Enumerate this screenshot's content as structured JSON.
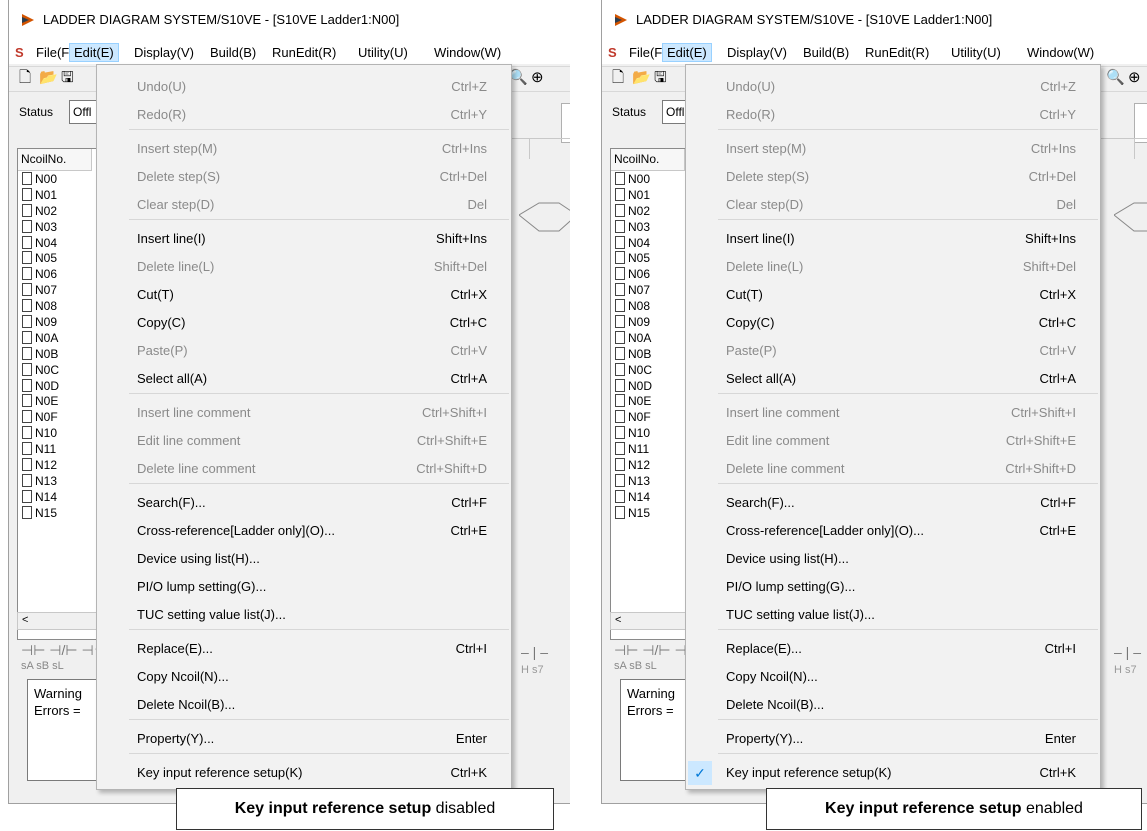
{
  "window_title": "LADDER DIAGRAM SYSTEM/S10VE - [S10VE Ladder1:N00]",
  "system_menu_icon": "S",
  "menubar": [
    {
      "label": "File(F)"
    },
    {
      "label": "Edit(E)"
    },
    {
      "label": "Display(V)"
    },
    {
      "label": "Build(B)"
    },
    {
      "label": "RunEdit(R)"
    },
    {
      "label": "Utility(U)"
    },
    {
      "label": "Window(W)"
    }
  ],
  "status_label": "Status",
  "status_value": "Offl",
  "list_header": "NcoilNo.",
  "ncoils": [
    "N00",
    "N01",
    "N02",
    "N03",
    "N04",
    "N05",
    "N06",
    "N07",
    "N08",
    "N09",
    "N0A",
    "N0B",
    "N0C",
    "N0D",
    "N0E",
    "N0F",
    "N10",
    "N11",
    "N12",
    "N13",
    "N14",
    "N15"
  ],
  "scroll_left": "<",
  "ladder_symbols": "sA  sB  sL",
  "ladder_symbols_right": "H   s7",
  "messages": [
    "Warning",
    "Errors ="
  ],
  "edit_menu": [
    {
      "label": "Undo(U)",
      "shortcut": "Ctrl+Z",
      "enabled": false
    },
    {
      "label": "Redo(R)",
      "shortcut": "Ctrl+Y",
      "enabled": false
    },
    {
      "label": "Insert step(M)",
      "shortcut": "Ctrl+Ins",
      "enabled": false
    },
    {
      "label": "Delete step(S)",
      "shortcut": "Ctrl+Del",
      "enabled": false
    },
    {
      "label": "Clear step(D)",
      "shortcut": "Del",
      "enabled": false
    },
    {
      "label": "Insert line(I)",
      "shortcut": "Shift+Ins",
      "enabled": true
    },
    {
      "label": "Delete line(L)",
      "shortcut": "Shift+Del",
      "enabled": false
    },
    {
      "label": "Cut(T)",
      "shortcut": "Ctrl+X",
      "enabled": true
    },
    {
      "label": "Copy(C)",
      "shortcut": "Ctrl+C",
      "enabled": true
    },
    {
      "label": "Paste(P)",
      "shortcut": "Ctrl+V",
      "enabled": false
    },
    {
      "label": "Select all(A)",
      "shortcut": "Ctrl+A",
      "enabled": true
    },
    {
      "label": "Insert line comment",
      "shortcut": "Ctrl+Shift+I",
      "enabled": false
    },
    {
      "label": "Edit line comment",
      "shortcut": "Ctrl+Shift+E",
      "enabled": false
    },
    {
      "label": "Delete line comment",
      "shortcut": "Ctrl+Shift+D",
      "enabled": false
    },
    {
      "label": "Search(F)...",
      "shortcut": "Ctrl+F",
      "enabled": true
    },
    {
      "label": "Cross-reference[Ladder only](O)...",
      "shortcut": "Ctrl+E",
      "enabled": true
    },
    {
      "label": "Device using list(H)...",
      "shortcut": "",
      "enabled": true
    },
    {
      "label": "PI/O lump setting(G)...",
      "shortcut": "",
      "enabled": true
    },
    {
      "label": "TUC setting value list(J)...",
      "shortcut": "",
      "enabled": true
    },
    {
      "label": "Replace(E)...",
      "shortcut": "Ctrl+I",
      "enabled": true
    },
    {
      "label": "Copy Ncoil(N)...",
      "shortcut": "",
      "enabled": true
    },
    {
      "label": "Delete Ncoil(B)...",
      "shortcut": "",
      "enabled": true
    },
    {
      "label": "Property(Y)...",
      "shortcut": "Enter",
      "enabled": true
    },
    {
      "label": "Key input reference setup(K)",
      "shortcut": "Ctrl+K",
      "enabled": true
    }
  ],
  "panels": [
    {
      "caption_bold": "Key input reference setup",
      "caption_state": "disabled",
      "key_input_checked": false
    },
    {
      "caption_bold": "Key input reference setup",
      "caption_state": "enabled",
      "key_input_checked": true
    }
  ],
  "colors": {
    "highlight": "#cce8ff",
    "check": "#0078d7",
    "disabled_text": "#8a8a8a"
  }
}
